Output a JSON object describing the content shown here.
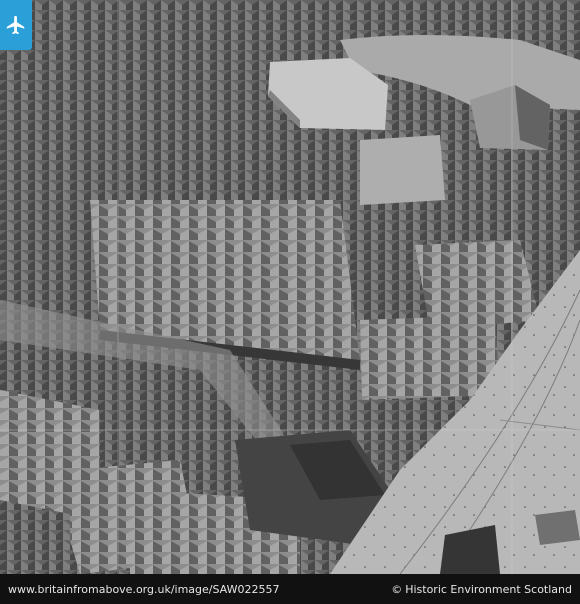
{
  "photo": {
    "alt": "Black and white aerial oblique photograph of a dense town centre with tenement blocks, a large hall, and a wide street with tramlines"
  },
  "branding": {
    "logo_icon": "airplane-icon",
    "accent": "#2a9fd8"
  },
  "footer": {
    "image_url": "www.britainfromabove.org.uk/image/SAW022557",
    "credit_symbol": "©",
    "credit_text": "Historic Environment Scotland"
  }
}
